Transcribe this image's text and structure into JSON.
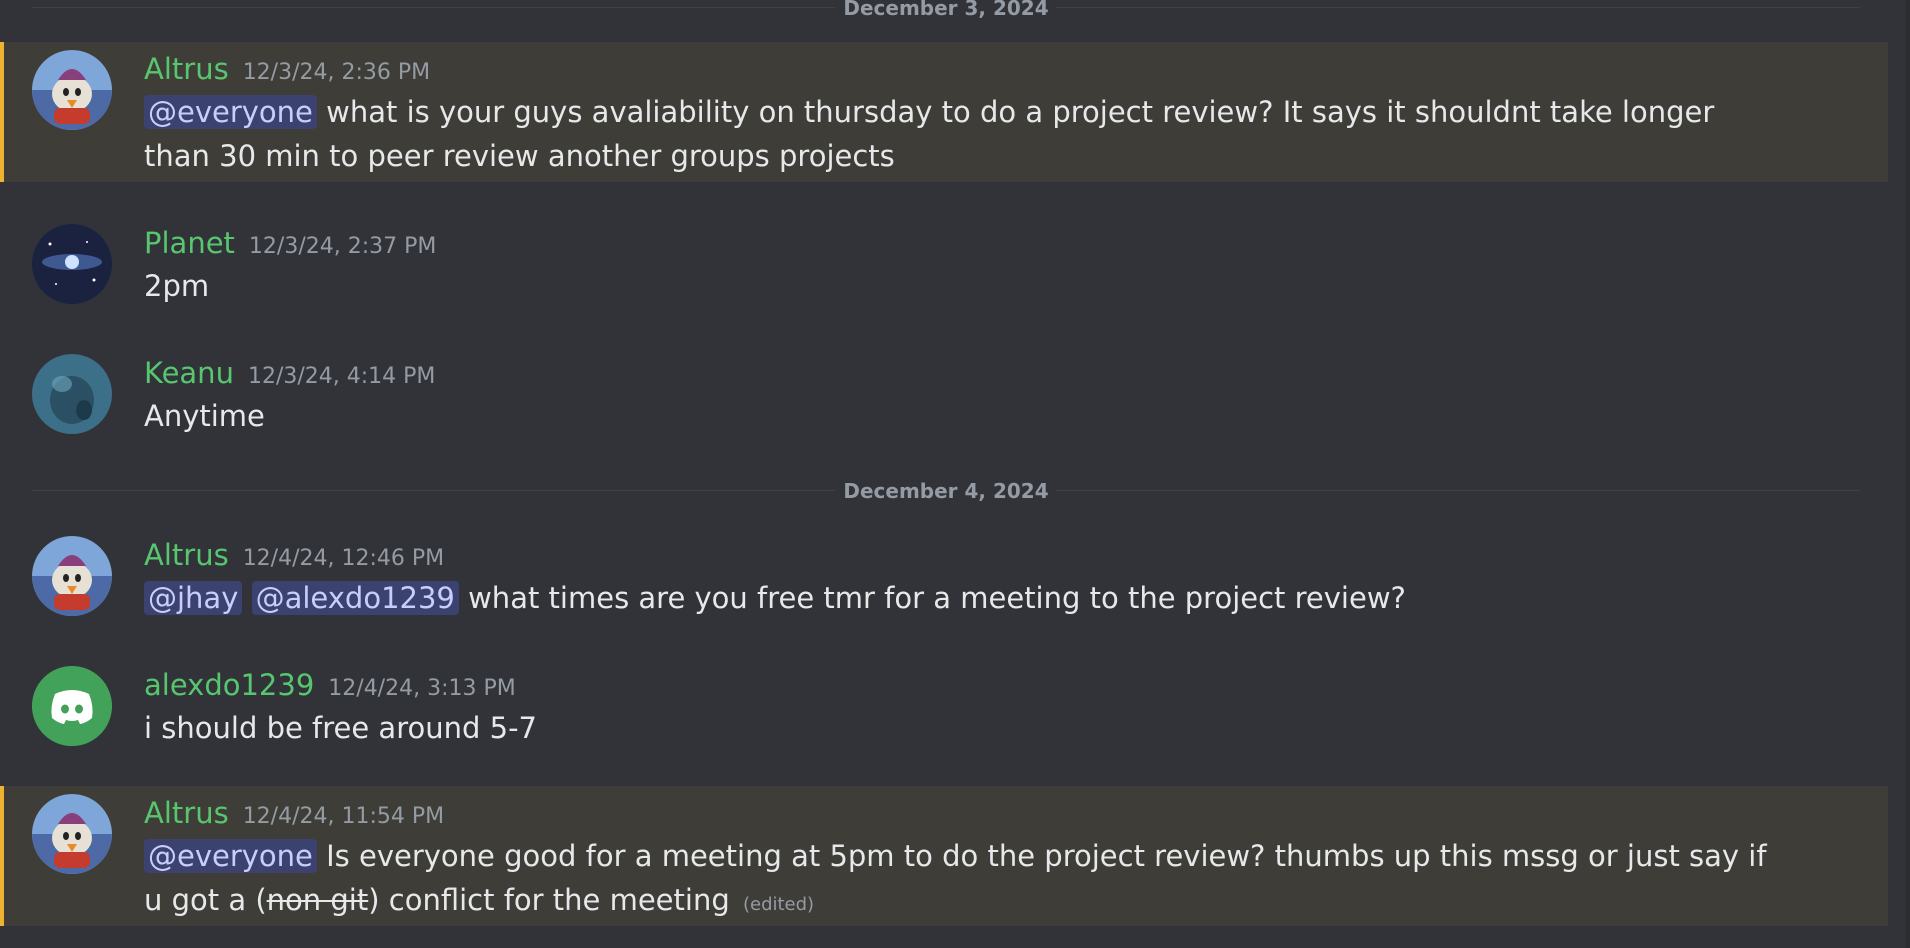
{
  "dividers": {
    "d1": "December 3, 2024",
    "d2": "December 4, 2024"
  },
  "messages": [
    {
      "author": "Altrus",
      "timestamp": "12/3/24, 2:36 PM",
      "mention": "@everyone",
      "text": "what is your guys avaliability on thursday to do a project review? It says it shouldnt take longer than 30 min to peer review another groups projects"
    },
    {
      "author": "Planet",
      "timestamp": "12/3/24, 2:37 PM",
      "text": "2pm"
    },
    {
      "author": "Keanu",
      "timestamp": "12/3/24, 4:14 PM",
      "text": "Anytime"
    },
    {
      "author": "Altrus",
      "timestamp": "12/4/24, 12:46 PM",
      "mention1": "@jhay",
      "mention2": "@alexdo1239",
      "text": "what times are you free tmr for a meeting to the project review?"
    },
    {
      "author": "alexdo1239",
      "timestamp": "12/4/24, 3:13 PM",
      "text": "i should be free around 5-7"
    },
    {
      "author": "Altrus",
      "timestamp": "12/4/24, 11:54 PM",
      "mention": "@everyone",
      "text": "Is everyone good for a meeting at 5pm to do the project review? thumbs up this mssg or just say if u got a",
      "paren_open": "(",
      "strike_text": "non git",
      "paren_close": ")",
      "text_end": "conflict for the meeting",
      "edited": "(edited)"
    }
  ]
}
